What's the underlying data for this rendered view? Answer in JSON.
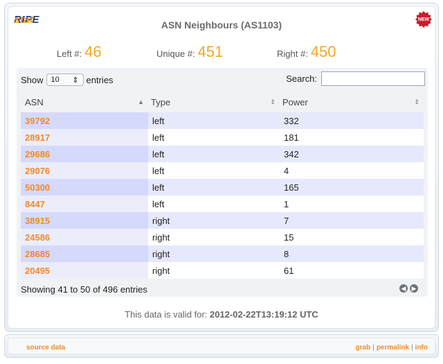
{
  "app": {
    "logo_ripe": "RIPE",
    "logo_stat": "stat",
    "title": "ASN Neighbours (AS1103)",
    "badge": "NEW"
  },
  "stats": {
    "left_label": "Left #:",
    "left_value": "46",
    "unique_label": "Unique #:",
    "unique_value": "451",
    "right_label": "Right #:",
    "right_value": "450"
  },
  "controls": {
    "show_label": "Show",
    "entries_value": "10",
    "entries_label": "entries",
    "search_label": "Search:",
    "search_value": ""
  },
  "table": {
    "headers": {
      "asn": "ASN",
      "type": "Type",
      "power": "Power"
    },
    "rows": [
      {
        "asn": "39792",
        "type": "left",
        "power": "332"
      },
      {
        "asn": "28917",
        "type": "left",
        "power": "181"
      },
      {
        "asn": "29686",
        "type": "left",
        "power": "342"
      },
      {
        "asn": "29076",
        "type": "left",
        "power": "4"
      },
      {
        "asn": "50300",
        "type": "left",
        "power": "165"
      },
      {
        "asn": "8447",
        "type": "left",
        "power": "1"
      },
      {
        "asn": "38915",
        "type": "right",
        "power": "7"
      },
      {
        "asn": "24586",
        "type": "right",
        "power": "15"
      },
      {
        "asn": "28685",
        "type": "right",
        "power": "8"
      },
      {
        "asn": "20495",
        "type": "right",
        "power": "61"
      }
    ],
    "info": "Showing 41 to 50 of 496 entries"
  },
  "validity": {
    "label": "This data is valid for:",
    "timestamp": "2012-02-22T13:19:12 UTC"
  },
  "footer": {
    "source": "source data",
    "grab": "grab",
    "permalink": "permalink",
    "info": "info",
    "sep": "|"
  },
  "colors": {
    "accent": "#f5a623",
    "link": "#ef8b26",
    "odd_row": "#e6e9fc",
    "badge": "#c81e2b"
  }
}
